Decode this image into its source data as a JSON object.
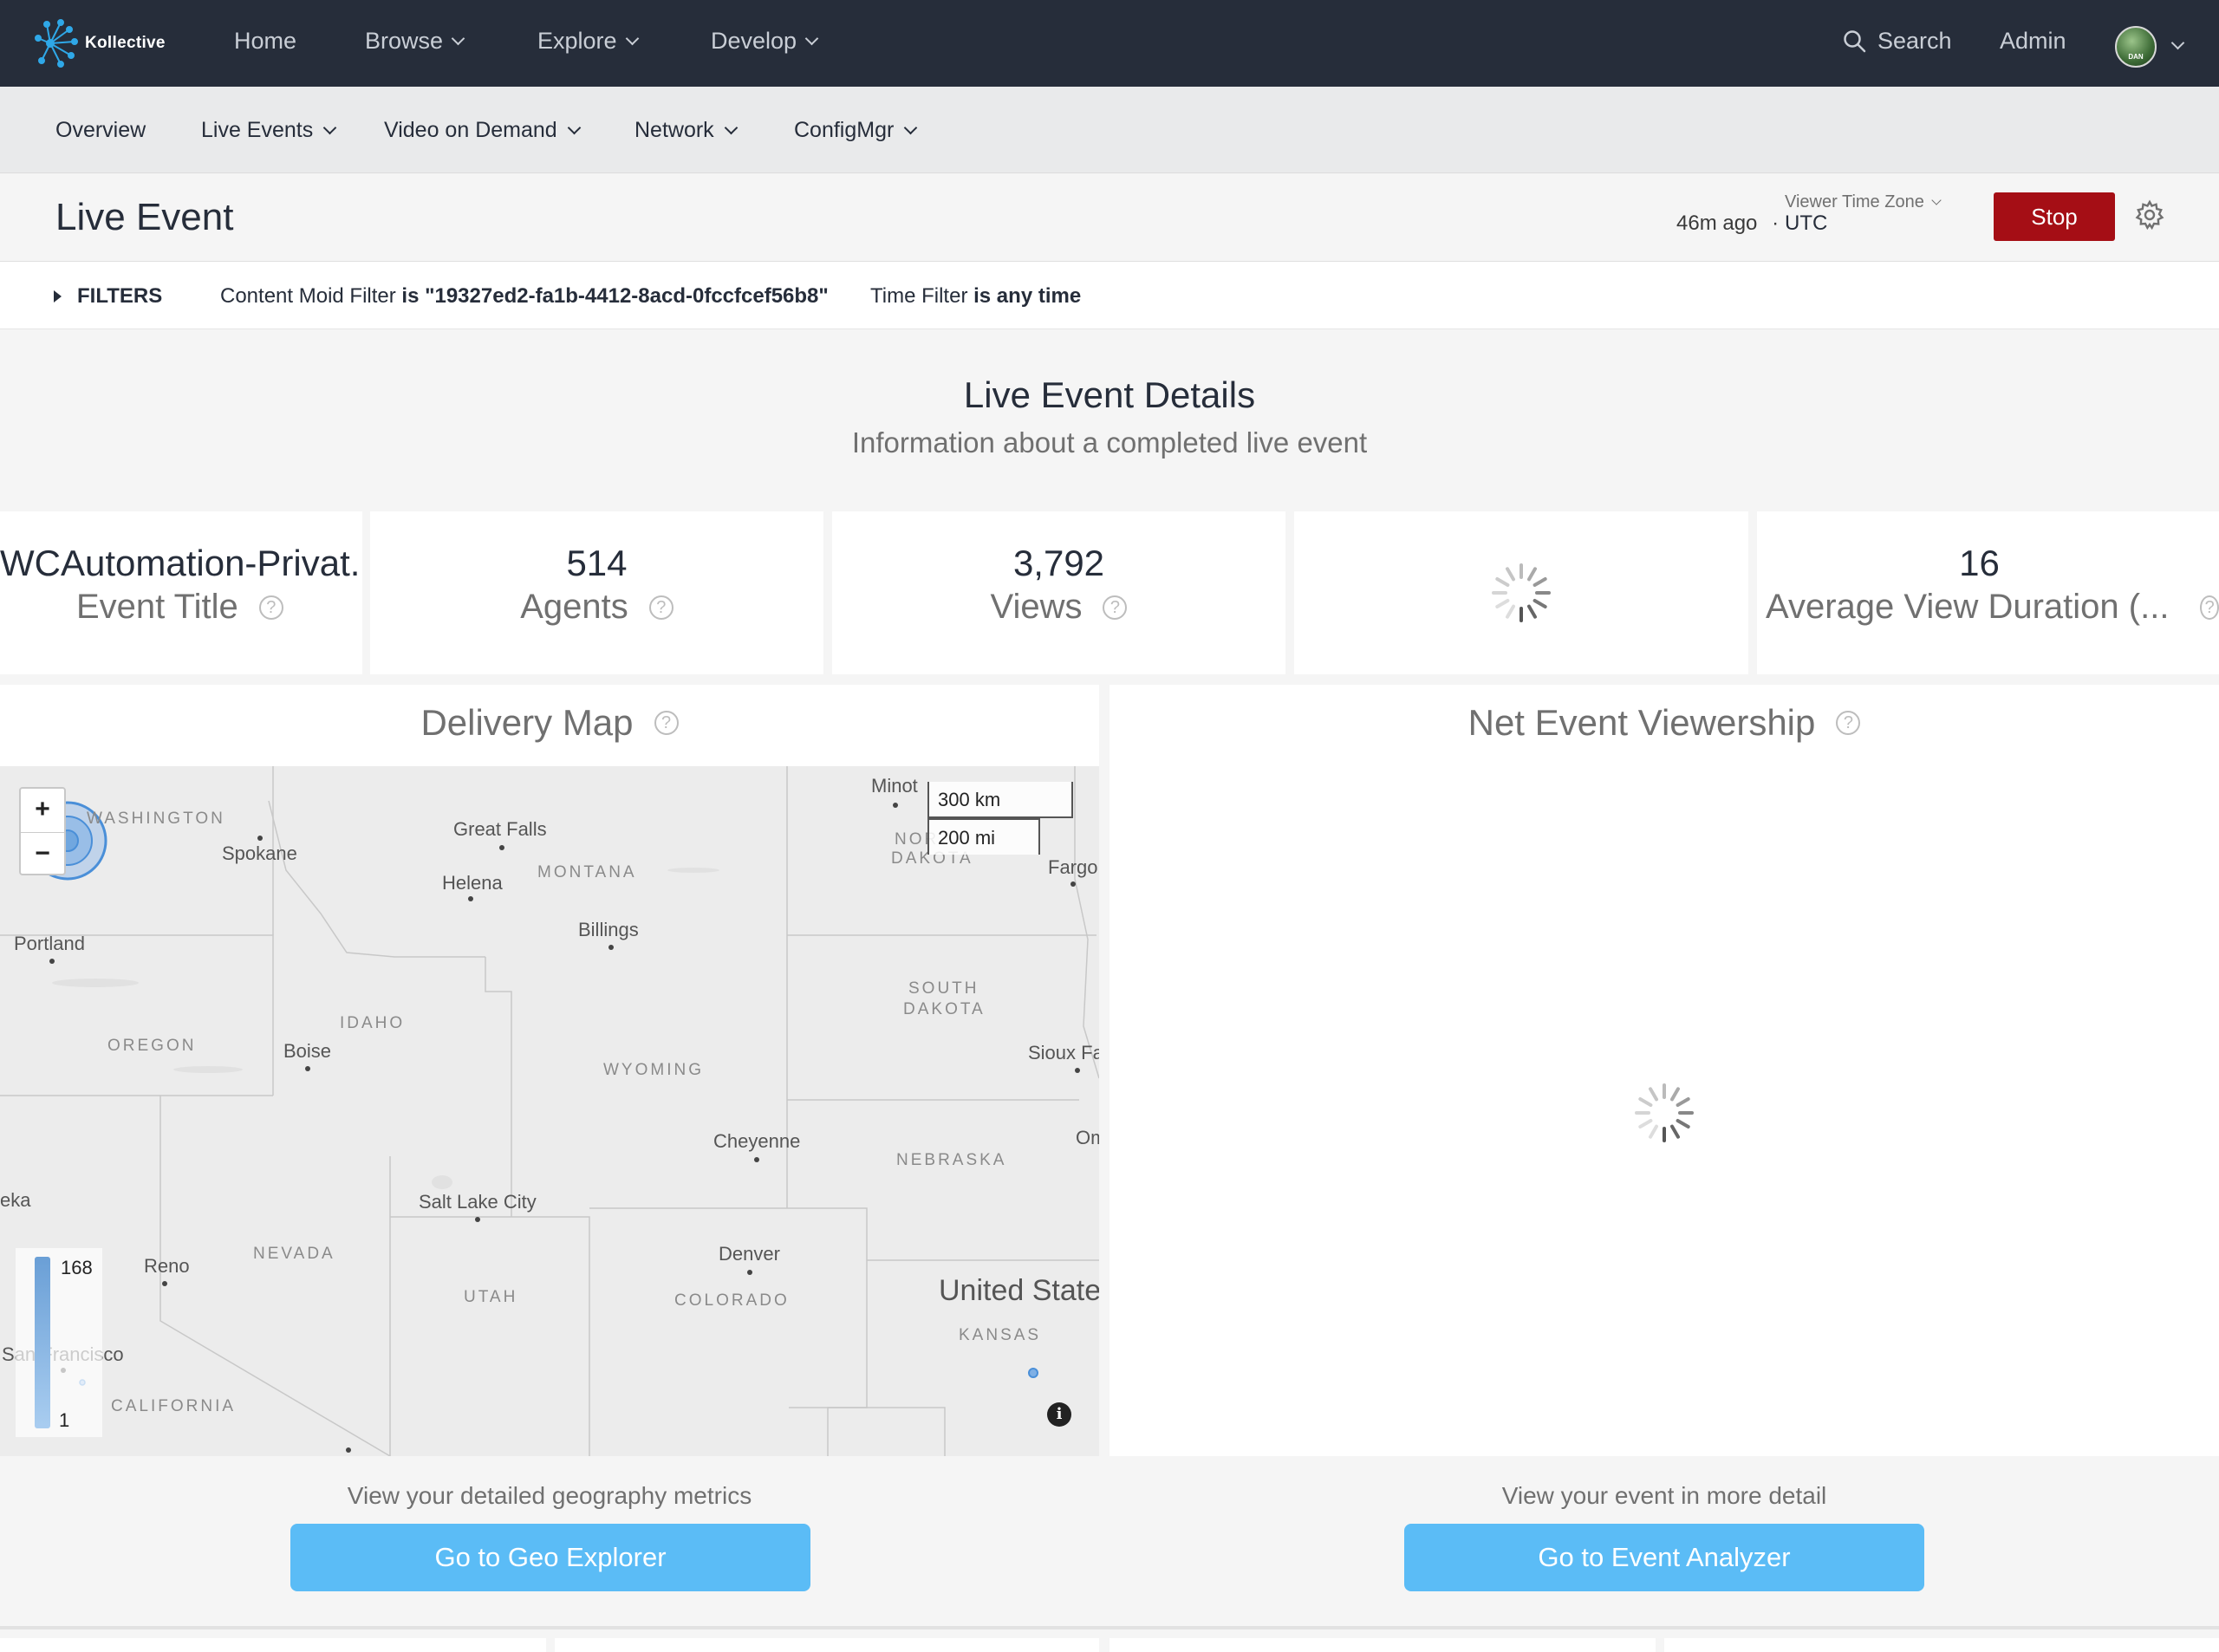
{
  "topnav": {
    "brand": "Kollective",
    "items": [
      {
        "label": "Home",
        "dropdown": false
      },
      {
        "label": "Browse",
        "dropdown": true
      },
      {
        "label": "Explore",
        "dropdown": true
      },
      {
        "label": "Develop",
        "dropdown": true
      }
    ],
    "search_label": "Search",
    "admin_label": "Admin",
    "avatar_text": "DAN"
  },
  "subnav": {
    "items": [
      {
        "label": "Overview",
        "dropdown": false
      },
      {
        "label": "Live Events",
        "dropdown": true
      },
      {
        "label": "Video on Demand",
        "dropdown": true
      },
      {
        "label": "Network",
        "dropdown": true
      },
      {
        "label": "ConfigMgr",
        "dropdown": true
      }
    ]
  },
  "header": {
    "title": "Live Event",
    "updated_ago": "46m ago",
    "separator": "·",
    "timezone_label": "Viewer Time Zone",
    "timezone_value": "UTC",
    "stop_label": "Stop"
  },
  "filters": {
    "toggle_label": "FILTERS",
    "content_filter_name": "Content Moid Filter",
    "content_filter_value": "is \"19327ed2-fa1b-4412-8acd-0fccfcef56b8\"",
    "time_filter_name": "Time Filter",
    "time_filter_value": "is any time"
  },
  "details": {
    "title": "Live Event Details",
    "subtitle": "Information about a completed live event"
  },
  "tiles": [
    {
      "value": "WCAutomation-Privat...",
      "label": "Event Title",
      "loading": false
    },
    {
      "value": "514",
      "label": "Agents",
      "loading": false
    },
    {
      "value": "3,792",
      "label": "Views",
      "loading": false
    },
    {
      "value": "",
      "label": "",
      "loading": true
    },
    {
      "value": "16",
      "label": "Average View Duration (...",
      "loading": false
    }
  ],
  "help_glyph": "?",
  "delivery_map": {
    "title": "Delivery Map",
    "zoom_in": "+",
    "zoom_out": "−",
    "scale_km": "300 km",
    "scale_mi": "200 mi",
    "legend_max": "168",
    "legend_min": "1",
    "info_glyph": "i",
    "country_label": "United State",
    "cities": [
      "Minot",
      "Great Falls",
      "Spokane",
      "Helena",
      "Fargo",
      "Billings",
      "Portland",
      "Sioux Fa",
      "Boise",
      "Cheyenne",
      "Om",
      "Salt Lake City",
      "eka",
      "Denver",
      "Reno",
      "San Francisco"
    ],
    "states": [
      "WASHINGTON",
      "MONTANA",
      "NOR",
      "DAKOTA",
      "SOUTH",
      "DAKOTA",
      "IDAHO",
      "OREGON",
      "WYOMING",
      "NEBRASKA",
      "NEVADA",
      "UTAH",
      "COLORADO",
      "KANSAS",
      "CALIFORNIA"
    ],
    "colors": {
      "marker": "#4a8fd8",
      "legend_top": "#6a9fd6",
      "legend_bottom": "#a9cdf0"
    }
  },
  "viewership": {
    "title": "Net Event Viewership",
    "loading": true
  },
  "actions": {
    "geo_text": "View your detailed geography metrics",
    "geo_button": "Go to Geo Explorer",
    "event_text": "View your event in more detail",
    "event_button": "Go to Event Analyzer"
  },
  "colors": {
    "topnav_bg": "#262d3a",
    "stop_bg": "#a50e15",
    "action_btn": "#5bbcf6"
  }
}
